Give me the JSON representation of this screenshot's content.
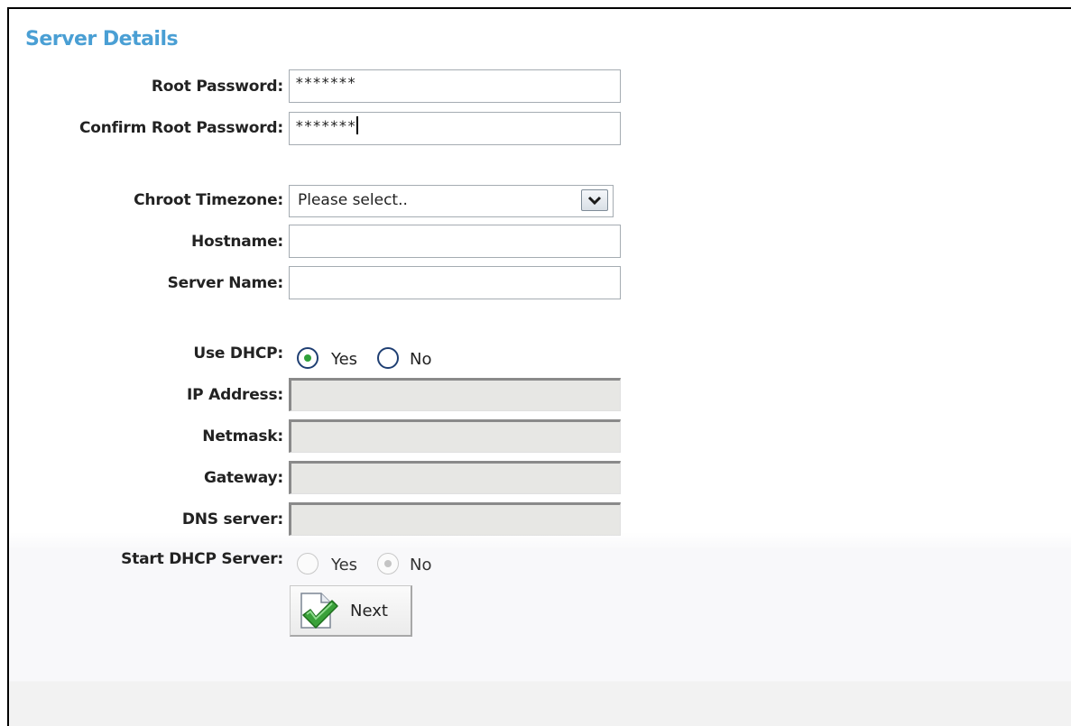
{
  "title": "Server Details",
  "fields": {
    "root_password": {
      "label": "Root Password:",
      "value": "*******"
    },
    "confirm_root_password": {
      "label": "Confirm Root Password:",
      "value": "*******"
    },
    "chroot_timezone": {
      "label": "Chroot Timezone:",
      "selected": "Please select.."
    },
    "hostname": {
      "label": "Hostname:",
      "value": ""
    },
    "server_name": {
      "label": "Server Name:",
      "value": ""
    },
    "use_dhcp": {
      "label": "Use DHCP:",
      "yes": "Yes",
      "no": "No",
      "selected": "Yes"
    },
    "ip_address": {
      "label": "IP Address:",
      "value": ""
    },
    "netmask": {
      "label": "Netmask:",
      "value": ""
    },
    "gateway": {
      "label": "Gateway:",
      "value": ""
    },
    "dns_server": {
      "label": "DNS server:",
      "value": ""
    },
    "start_dhcp_server": {
      "label": "Start DHCP Server:",
      "yes": "Yes",
      "no": "No",
      "selected": "No"
    }
  },
  "next_button": {
    "label": "Next",
    "icon": "checkmark-document-icon"
  },
  "colors": {
    "title": "#4a9fd4",
    "checked_radio": "#2fa13a",
    "check_icon": "#3aa13a"
  }
}
